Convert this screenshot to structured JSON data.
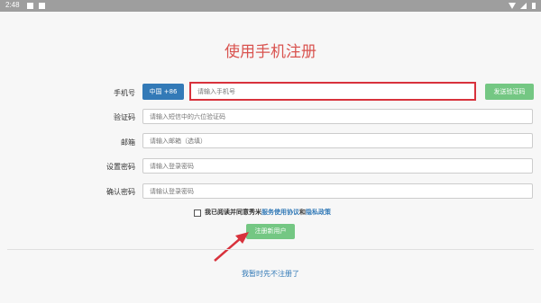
{
  "status_bar": {
    "time": "2:48",
    "left_icons": [
      "image-icon",
      "notification-icon"
    ],
    "right_icons": [
      "wifi-icon",
      "signal-icon",
      "battery-icon"
    ]
  },
  "page": {
    "title": "使用手机注册"
  },
  "form": {
    "phone": {
      "label": "手机号",
      "country_code_button": "中国 +86",
      "placeholder": "请输入手机号",
      "value": "",
      "send_code_button": "发送验证码"
    },
    "verification_code": {
      "label": "验证码",
      "placeholder": "请输入短信中的六位验证码",
      "value": ""
    },
    "email": {
      "label": "邮箱",
      "placeholder": "请输入邮箱（选填）",
      "value": ""
    },
    "password": {
      "label": "设置密码",
      "placeholder": "请输入登录密码",
      "value": ""
    },
    "confirm_password": {
      "label": "确认密码",
      "placeholder": "请输认登录密码",
      "value": ""
    },
    "agreement": {
      "checked": false,
      "text": "我已阅读并同意秀米",
      "terms_link": "服务使用协议",
      "and": "和",
      "privacy_link": "隐私政策"
    },
    "submit_button": "注册新用户"
  },
  "skip_link": "我暂时先不注册了",
  "colors": {
    "title": "#d9534f",
    "primary_blue": "#337ab7",
    "green_button": "#74c783",
    "highlight_red": "#d8323c",
    "status_bar": "#9e9e9e"
  }
}
